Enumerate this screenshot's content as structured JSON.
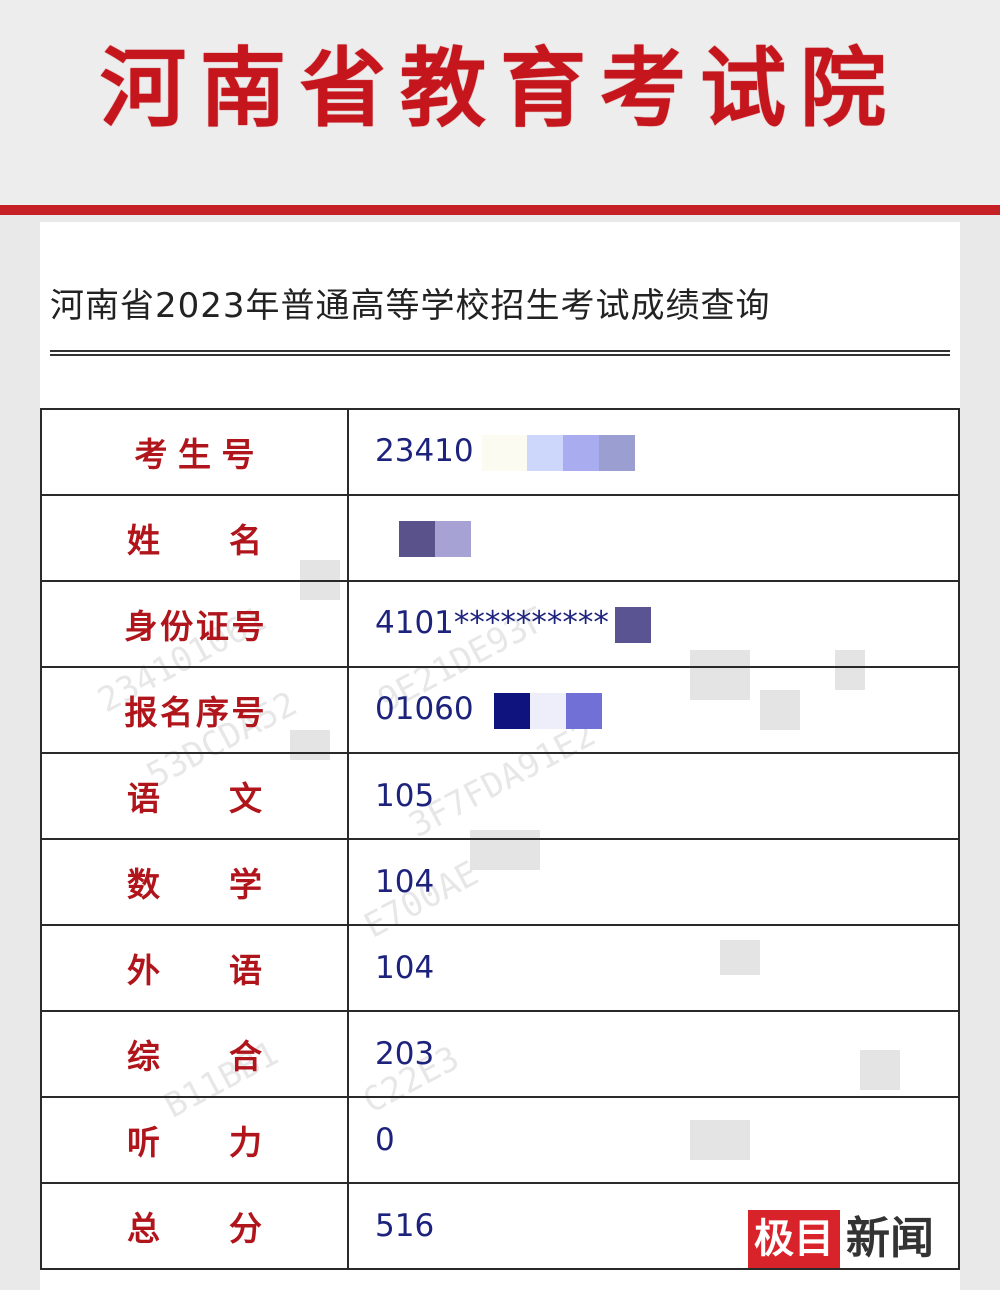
{
  "header": {
    "title": "河南省教育考试院"
  },
  "panel": {
    "query_title": "河南省2023年普通高等学校招生考试成绩查询"
  },
  "rows": [
    {
      "label": "考生号",
      "value": "23410"
    },
    {
      "label": "姓　　名",
      "value": ""
    },
    {
      "label": "身份证号",
      "value": "4101**********"
    },
    {
      "label": "报名序号",
      "value": "01060"
    },
    {
      "label": "语　　文",
      "value": "105"
    },
    {
      "label": "数　　学",
      "value": "104"
    },
    {
      "label": "外　　语",
      "value": "104"
    },
    {
      "label": "综　　合",
      "value": "203"
    },
    {
      "label": "听　　力",
      "value": "0"
    },
    {
      "label": "总　　分",
      "value": "516"
    }
  ],
  "watermark": {
    "texts": [
      "234101061",
      "53DCDA52",
      "B11BB1",
      "3F7FDA91E2",
      "E700AE",
      "9E21DE93F",
      "C22E3"
    ]
  },
  "logo": {
    "box_text": "极目",
    "text": "新闻"
  },
  "colors": {
    "brand_red": "#c4161c",
    "label_red": "#b0151c",
    "value_navy": "#1d237c"
  }
}
